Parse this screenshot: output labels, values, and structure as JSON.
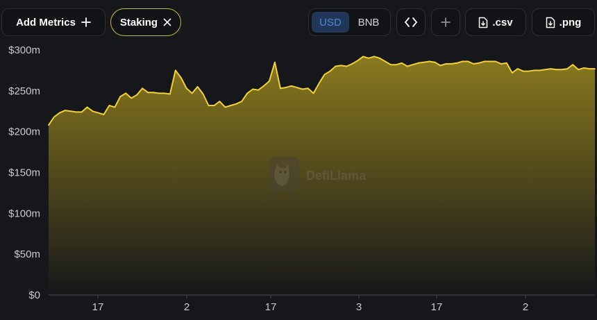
{
  "toolbar": {
    "add_metrics_label": "Add Metrics",
    "staking_label": "Staking",
    "currency_options": [
      "USD",
      "BNB"
    ],
    "currency_selected": "USD",
    "csv_label": ".csv",
    "png_label": ".png"
  },
  "watermark": {
    "text": "DefiLlama"
  },
  "colors": {
    "line": "#f2d13a",
    "fill_top": "#8a7a1e",
    "fill_bottom": "#16171a",
    "accent_blue": "#4e8ad8"
  },
  "chart_data": {
    "type": "area",
    "title": "",
    "xlabel": "",
    "ylabel": "",
    "ylim": [
      0,
      300
    ],
    "y_unit": "m",
    "y_ticks": [
      "$0",
      "$50m",
      "$100m",
      "$150m",
      "$200m",
      "$250m",
      "$300m"
    ],
    "x_ticks": [
      "17",
      "2",
      "17",
      "3",
      "17",
      "2"
    ],
    "grid": false,
    "series": [
      {
        "values": [
          208,
          218,
          223,
          226,
          225,
          224,
          224,
          230,
          225,
          223,
          221,
          232,
          230,
          243,
          247,
          241,
          245,
          253,
          248,
          248,
          247,
          247,
          246,
          275,
          266,
          253,
          247,
          255,
          246,
          232,
          232,
          237,
          230,
          232,
          234,
          237,
          247,
          252,
          251,
          256,
          262,
          285,
          253,
          254,
          256,
          254,
          252,
          253,
          247,
          259,
          270,
          274,
          280,
          281,
          280,
          283,
          287,
          292,
          290,
          292,
          290,
          286,
          282,
          282,
          284,
          280,
          282,
          284,
          285,
          286,
          285,
          281,
          283,
          283,
          284,
          286,
          286,
          283,
          284,
          286,
          286,
          286,
          283,
          284,
          272,
          277,
          274,
          274,
          275,
          275,
          276,
          277,
          276,
          276,
          277,
          282,
          276,
          278,
          277,
          277
        ]
      }
    ]
  }
}
